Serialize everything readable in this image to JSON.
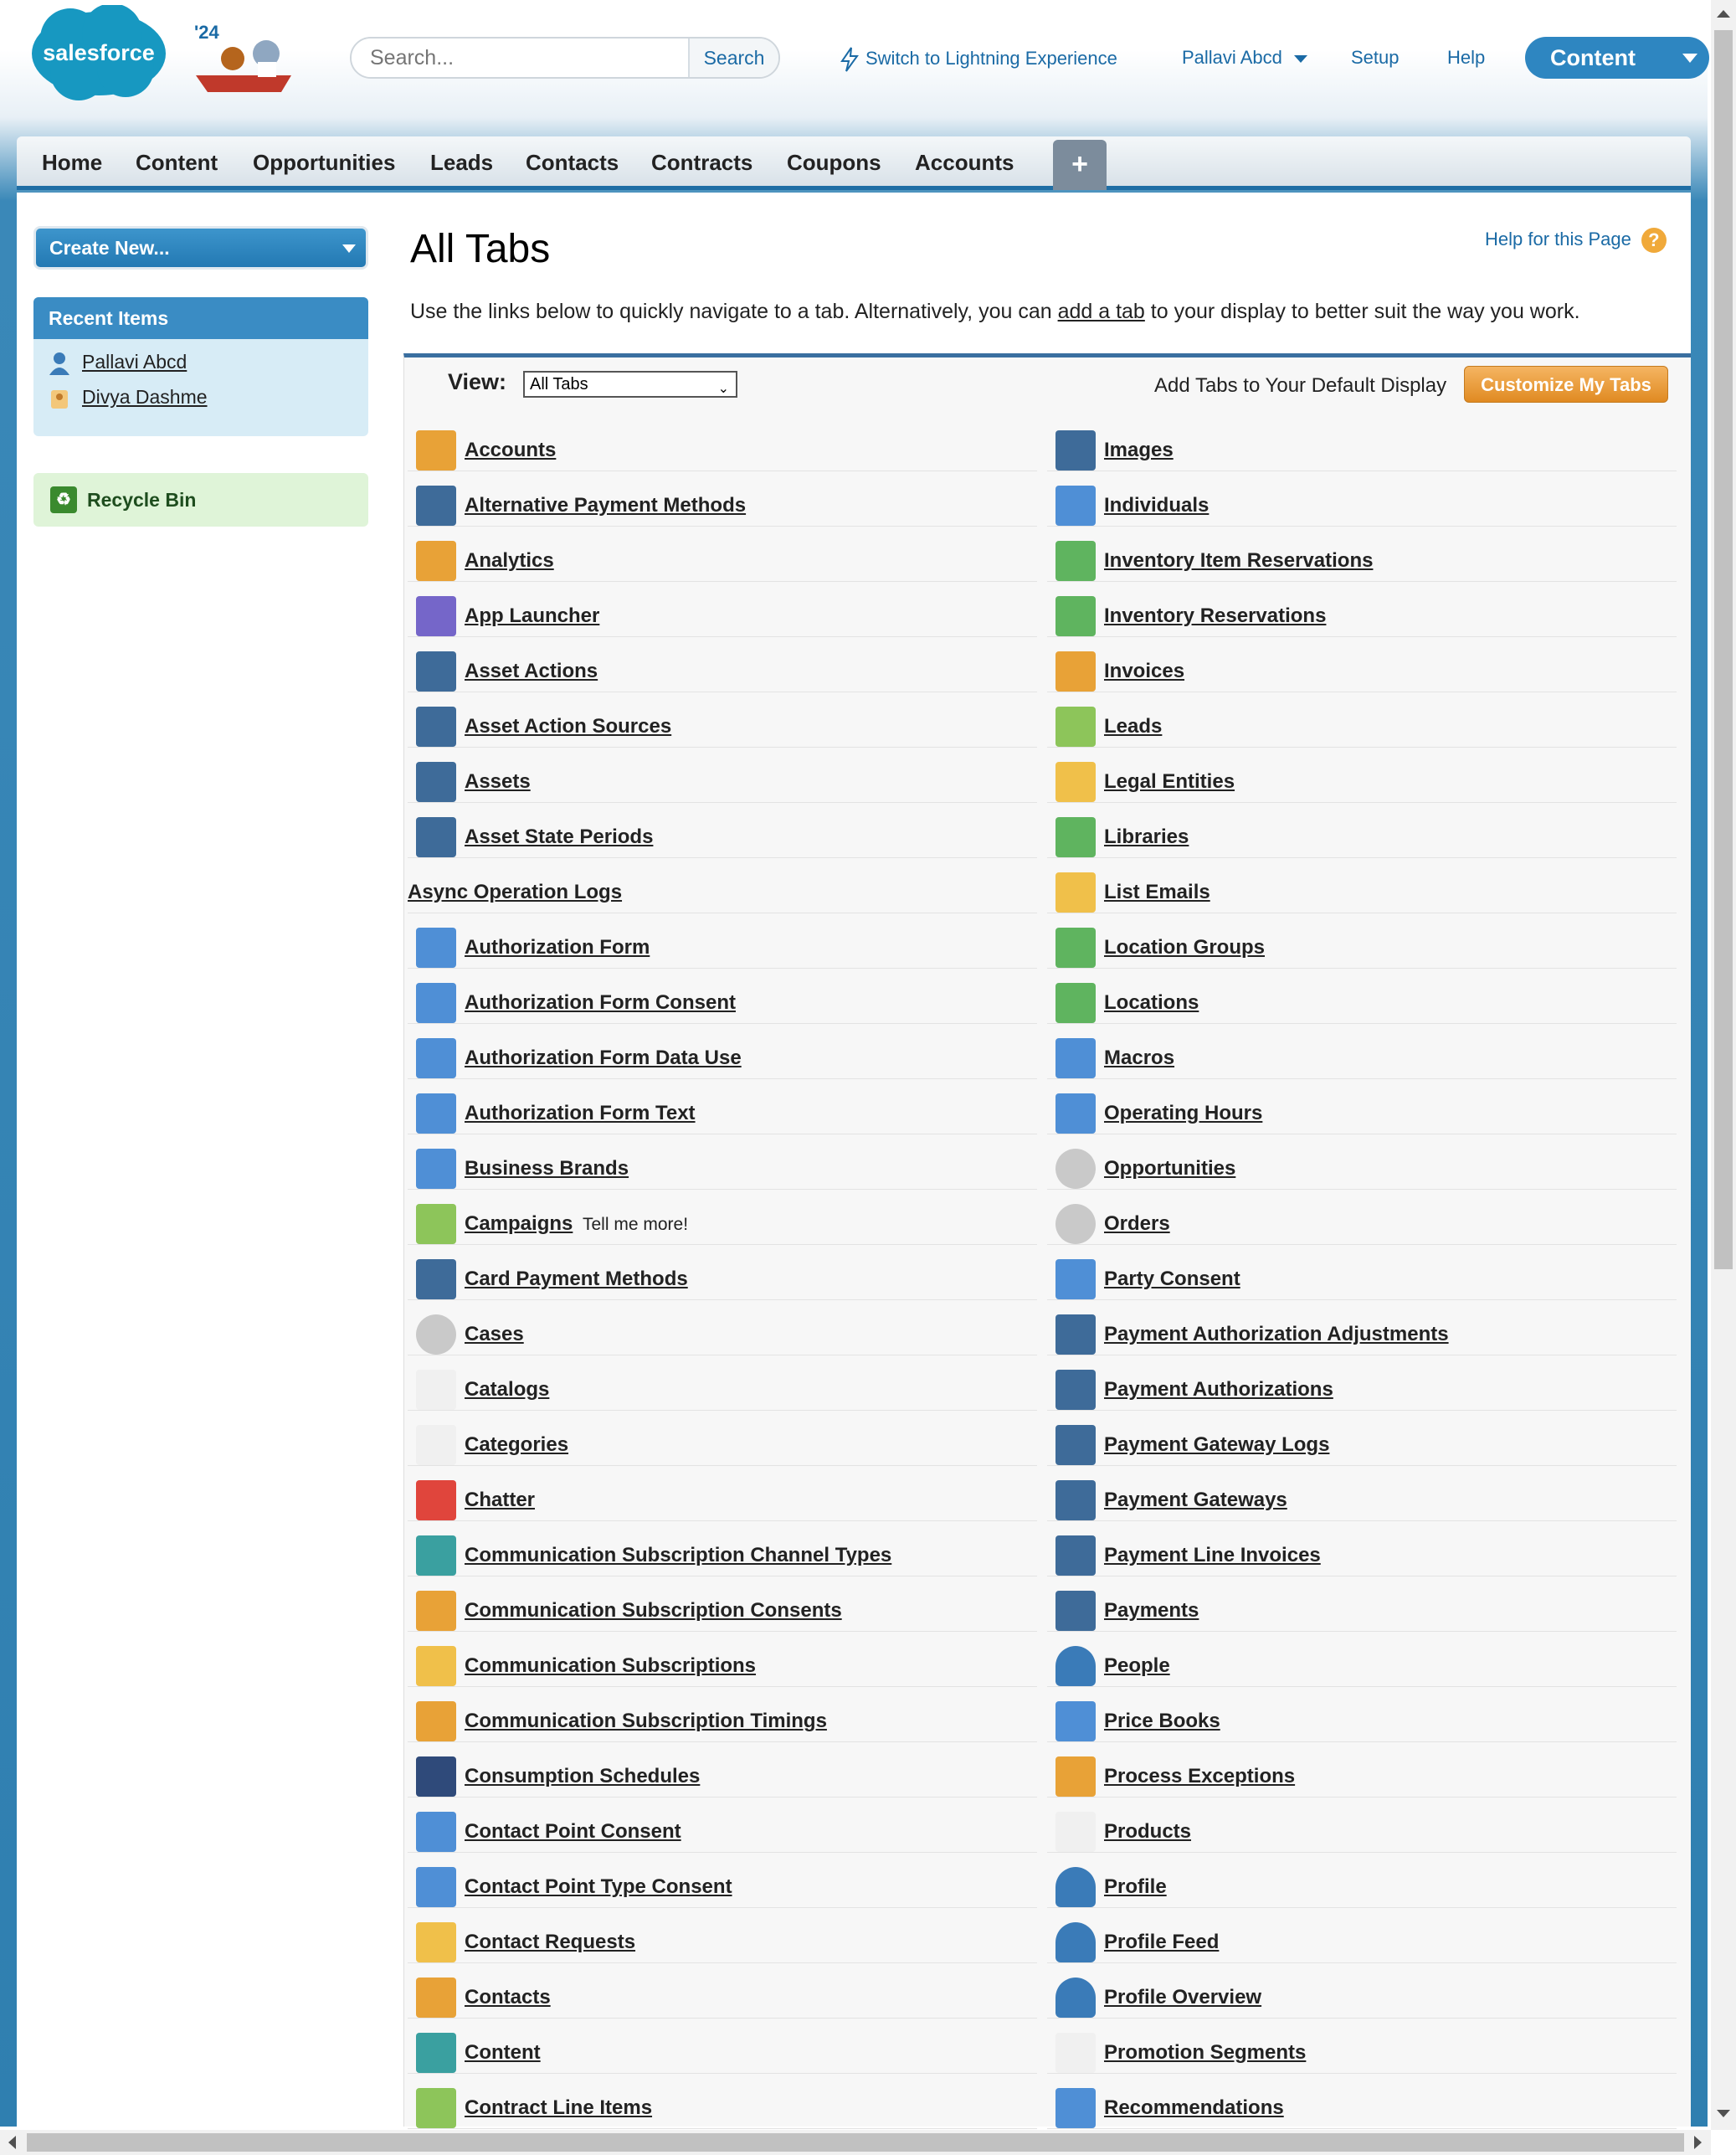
{
  "header": {
    "search_placeholder": "Search...",
    "search_button": "Search",
    "lightning_link": "Switch to Lightning Experience",
    "user_menu": "Pallavi Abcd",
    "setup": "Setup",
    "help": "Help",
    "app_menu": "Content",
    "logo_text": "salesforce",
    "mascot_year": "'24"
  },
  "tabs": [
    "Home",
    "Content",
    "Opportunities",
    "Leads",
    "Contacts",
    "Contracts",
    "Coupons",
    "Accounts"
  ],
  "tab_plus": "+",
  "sidebar": {
    "create_new": "Create New...",
    "recent_items_title": "Recent Items",
    "recent_items": [
      "Pallavi Abcd",
      "Divya Dashme"
    ],
    "recycle_bin": "Recycle Bin"
  },
  "main": {
    "title": "All Tabs",
    "help_link": "Help for this Page",
    "desc_before": "Use the links below to quickly navigate to a tab. Alternatively, you can ",
    "desc_link": "add a tab",
    "desc_after": " to your display to better suit the way you work.",
    "view_label": "View:",
    "view_selected": "All Tabs",
    "add_tabs_text": "Add Tabs to Your Default Display",
    "customize_button": "Customize My Tabs"
  },
  "left_column": [
    {
      "name": "Accounts",
      "icon": "folder-icon",
      "color": "orange"
    },
    {
      "name": "Alternative Payment Methods",
      "icon": "payment-icon",
      "color": "blue"
    },
    {
      "name": "Analytics",
      "icon": "bar-chart-icon",
      "color": "orange"
    },
    {
      "name": "App Launcher",
      "icon": "app-launcher-icon",
      "color": "purple"
    },
    {
      "name": "Asset Actions",
      "icon": "asset-icon",
      "color": "blue"
    },
    {
      "name": "Asset Action Sources",
      "icon": "asset-icon",
      "color": "blue"
    },
    {
      "name": "Assets",
      "icon": "asset-icon",
      "color": "blue"
    },
    {
      "name": "Asset State Periods",
      "icon": "asset-icon",
      "color": "blue"
    },
    {
      "name": "Async Operation Logs",
      "icon": "",
      "color": ""
    },
    {
      "name": "Authorization Form",
      "icon": "person-db-icon",
      "color": "lblue"
    },
    {
      "name": "Authorization Form Consent",
      "icon": "person-db-icon",
      "color": "lblue"
    },
    {
      "name": "Authorization Form Data Use",
      "icon": "person-db-icon",
      "color": "lblue"
    },
    {
      "name": "Authorization Form Text",
      "icon": "person-db-icon",
      "color": "lblue"
    },
    {
      "name": "Business Brands",
      "icon": "person-db-icon",
      "color": "lblue"
    },
    {
      "name": "Campaigns",
      "icon": "target-icon",
      "color": "lgreen",
      "extra": "Tell me more!"
    },
    {
      "name": "Card Payment Methods",
      "icon": "payment-icon",
      "color": "blue"
    },
    {
      "name": "Cases",
      "icon": "case-icon",
      "color": "gray"
    },
    {
      "name": "Catalogs",
      "icon": "faint-icon",
      "color": "faint"
    },
    {
      "name": "Categories",
      "icon": "faint-icon",
      "color": "faint"
    },
    {
      "name": "Chatter",
      "icon": "chatter-icon",
      "color": "red"
    },
    {
      "name": "Communication Subscription Channel Types",
      "icon": "subscription-icon",
      "color": "teal"
    },
    {
      "name": "Communication Subscription Consents",
      "icon": "people-icon",
      "color": "orange"
    },
    {
      "name": "Communication Subscriptions",
      "icon": "envelope-icon",
      "color": "yellow"
    },
    {
      "name": "Communication Subscription Timings",
      "icon": "clock-icon",
      "color": "orange"
    },
    {
      "name": "Consumption Schedules",
      "icon": "schedule-icon",
      "color": "navy"
    },
    {
      "name": "Contact Point Consent",
      "icon": "person-db-icon",
      "color": "lblue"
    },
    {
      "name": "Contact Point Type Consent",
      "icon": "person-db-icon",
      "color": "lblue"
    },
    {
      "name": "Contact Requests",
      "icon": "envelope-icon",
      "color": "yellow"
    },
    {
      "name": "Contacts",
      "icon": "contact-card-icon",
      "color": "orange"
    },
    {
      "name": "Content",
      "icon": "content-icon",
      "color": "teal"
    },
    {
      "name": "Contract Line Items",
      "icon": "document-icon",
      "color": "lgreen"
    }
  ],
  "right_column": [
    {
      "name": "Images",
      "icon": "payment-icon",
      "color": "blue"
    },
    {
      "name": "Individuals",
      "icon": "person-db-icon",
      "color": "lblue"
    },
    {
      "name": "Inventory Item Reservations",
      "icon": "location-icon",
      "color": "green"
    },
    {
      "name": "Inventory Reservations",
      "icon": "location-icon",
      "color": "green"
    },
    {
      "name": "Invoices",
      "icon": "calculator-icon",
      "color": "orange"
    },
    {
      "name": "Leads",
      "icon": "lead-icon",
      "color": "lgreen"
    },
    {
      "name": "Legal Entities",
      "icon": "ribbon-icon",
      "color": "yellow"
    },
    {
      "name": "Libraries",
      "icon": "library-icon",
      "color": "green"
    },
    {
      "name": "List Emails",
      "icon": "envelope-icon",
      "color": "yellow"
    },
    {
      "name": "Location Groups",
      "icon": "location-icon",
      "color": "green"
    },
    {
      "name": "Locations",
      "icon": "location-icon",
      "color": "green"
    },
    {
      "name": "Macros",
      "icon": "lightning-icon",
      "color": "lblue"
    },
    {
      "name": "Operating Hours",
      "icon": "clock-icon",
      "color": "lblue"
    },
    {
      "name": "Opportunities",
      "icon": "compass-icon",
      "color": "gray"
    },
    {
      "name": "Orders",
      "icon": "bell-icon",
      "color": "gray"
    },
    {
      "name": "Party Consent",
      "icon": "person-db-icon",
      "color": "lblue"
    },
    {
      "name": "Payment Authorization Adjustments",
      "icon": "payment-icon",
      "color": "blue"
    },
    {
      "name": "Payment Authorizations",
      "icon": "payment-icon",
      "color": "blue"
    },
    {
      "name": "Payment Gateway Logs",
      "icon": "payment-icon",
      "color": "blue"
    },
    {
      "name": "Payment Gateways",
      "icon": "payment-icon",
      "color": "blue"
    },
    {
      "name": "Payment Line Invoices",
      "icon": "payment-icon",
      "color": "blue"
    },
    {
      "name": "Payments",
      "icon": "payment-icon",
      "color": "blue"
    },
    {
      "name": "People",
      "icon": "person-icon",
      "color": "person"
    },
    {
      "name": "Price Books",
      "icon": "book-icon",
      "color": "lblue"
    },
    {
      "name": "Process Exceptions",
      "icon": "exception-icon",
      "color": "orange"
    },
    {
      "name": "Products",
      "icon": "faint-icon",
      "color": "faint"
    },
    {
      "name": "Profile",
      "icon": "person-icon",
      "color": "person"
    },
    {
      "name": "Profile Feed",
      "icon": "person-icon",
      "color": "person"
    },
    {
      "name": "Profile Overview",
      "icon": "person-icon",
      "color": "person"
    },
    {
      "name": "Promotion Segments",
      "icon": "faint-icon",
      "color": "faint"
    },
    {
      "name": "Recommendations",
      "icon": "hand-icon",
      "color": "lblue"
    }
  ]
}
